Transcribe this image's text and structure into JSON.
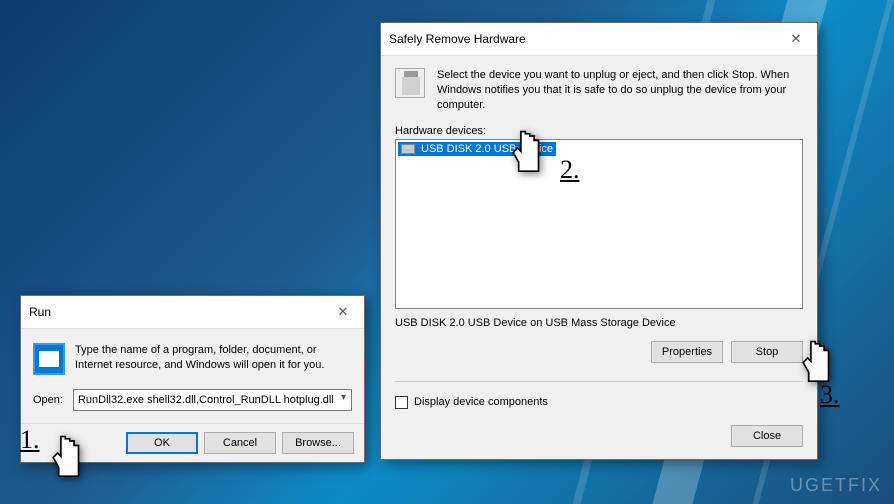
{
  "run": {
    "title": "Run",
    "description": "Type the name of a program, folder, document, or Internet resource, and Windows will open it for you.",
    "open_label": "Open:",
    "input_value": "RunDll32.exe shell32.dll,Control_RunDLL hotplug.dll",
    "buttons": {
      "ok": "OK",
      "cancel": "Cancel",
      "browse": "Browse..."
    }
  },
  "srh": {
    "title": "Safely Remove Hardware",
    "description": "Select the device you want to unplug or eject, and then click Stop. When Windows notifies you that it is safe to do so unplug the device from your computer.",
    "hw_label": "Hardware devices:",
    "device": "USB DISK 2.0 USB Device",
    "status": "USB DISK 2.0 USB Device on USB Mass Storage Device",
    "buttons": {
      "properties": "Properties",
      "stop": "Stop",
      "close": "Close"
    },
    "display_components": "Display device components"
  },
  "annotations": {
    "one": "1.",
    "two": "2.",
    "three": "3."
  },
  "watermark": "UGETFIX"
}
